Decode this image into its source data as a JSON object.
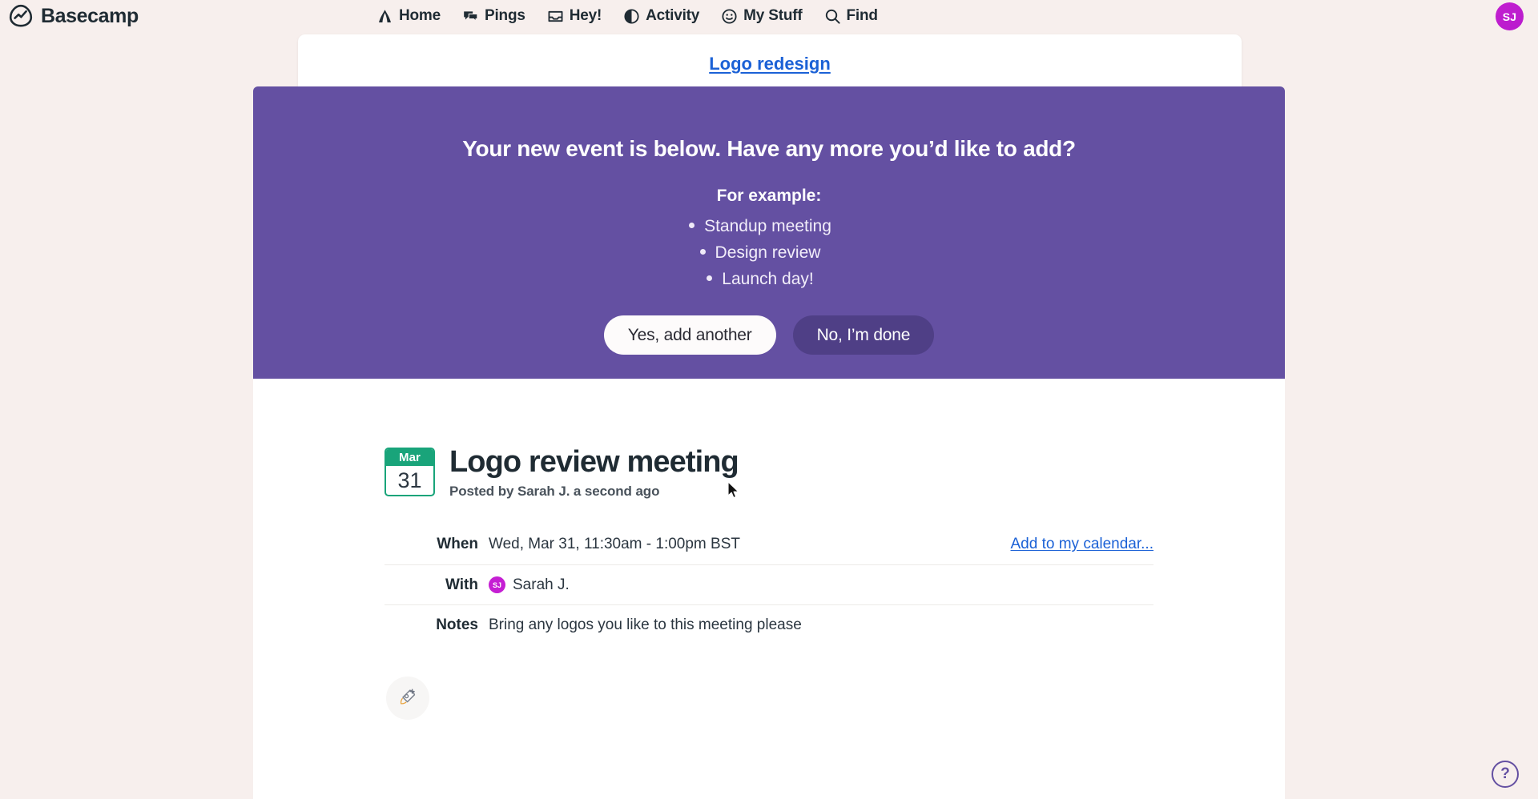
{
  "brand": {
    "name": "Basecamp",
    "logo_icon": "basecamp-logo-icon"
  },
  "nav": {
    "items": [
      {
        "label": "Home",
        "icon": "home-icon"
      },
      {
        "label": "Pings",
        "icon": "chat-bubbles-icon"
      },
      {
        "label": "Hey!",
        "icon": "inbox-tray-icon"
      },
      {
        "label": "Activity",
        "icon": "pie-clock-icon"
      },
      {
        "label": "My Stuff",
        "icon": "smiley-face-icon"
      },
      {
        "label": "Find",
        "icon": "search-icon"
      }
    ],
    "avatar_initials": "SJ",
    "avatar_color": "#c51fd3"
  },
  "project": {
    "link_label": "Logo redesign",
    "link_color": "#1b61d6"
  },
  "prompt": {
    "background_color": "#6450a2",
    "headline": "Your new event is below. Have any more you’d like to add?",
    "example_label": "For example:",
    "examples": [
      "Standup meeting",
      "Design review",
      "Launch day!"
    ],
    "primary_button": "Yes, add another",
    "secondary_button": "No, I’m done"
  },
  "event": {
    "date_badge": {
      "month": "Mar",
      "day": "31",
      "color": "#19a47a"
    },
    "title": "Logo review meeting",
    "byline": "Posted by Sarah J. a second ago",
    "details": [
      {
        "label": "When",
        "value": "Wed, Mar 31, 11:30am - 1:00pm BST",
        "action_label": "Add to my calendar...",
        "avatar_initials": null
      },
      {
        "label": "With",
        "value": "Sarah J.",
        "action_label": null,
        "avatar_initials": "SJ"
      },
      {
        "label": "Notes",
        "value": "Bring any logos you like to this meeting please",
        "action_label": null,
        "avatar_initials": null
      }
    ],
    "boost_icon": "rocket-plus-icon"
  },
  "help": {
    "label": "?",
    "icon": "question-mark-circle-icon"
  }
}
